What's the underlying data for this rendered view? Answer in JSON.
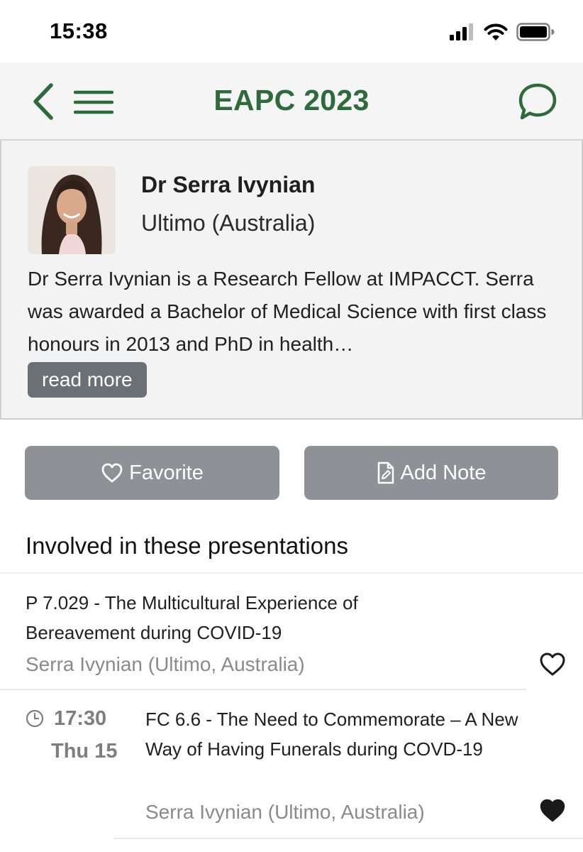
{
  "status_bar": {
    "time": "15:38",
    "icons": [
      "cellular-signal-icon",
      "wifi-icon",
      "battery-icon"
    ]
  },
  "nav": {
    "title": "EAPC 2023",
    "icons": [
      "back-chevron-icon",
      "hamburger-menu-icon",
      "chat-bubble-icon"
    ],
    "accent_color": "#2e6b3a"
  },
  "speaker": {
    "name": "Dr Serra Ivynian",
    "location": "Ultimo (Australia)",
    "bio": "Dr Serra Ivynian is a Research Fellow at IMPACCT. Serra was awarded a Bachelor of Medical Science with first class honours in 2013 and PhD in health…",
    "read_more_label": "read more"
  },
  "actions": {
    "favorite_label": "Favorite",
    "add_note_label": "Add Note",
    "button_color": "#8e9296"
  },
  "presentations": {
    "section_title": "Involved in these presentations",
    "items": [
      {
        "title": "P 7.029 - The Multicultural Experience of Bereavement during COVID-19",
        "author": "Serra Ivynian (Ultimo, Australia)",
        "favorited": false
      },
      {
        "time": "17:30",
        "day": "Thu 15",
        "title": "FC 6.6 - The Need to Commemorate – A New Way of Having Funerals during COVD-19",
        "author": "Serra Ivynian (Ultimo, Australia)",
        "favorited": true
      }
    ]
  }
}
